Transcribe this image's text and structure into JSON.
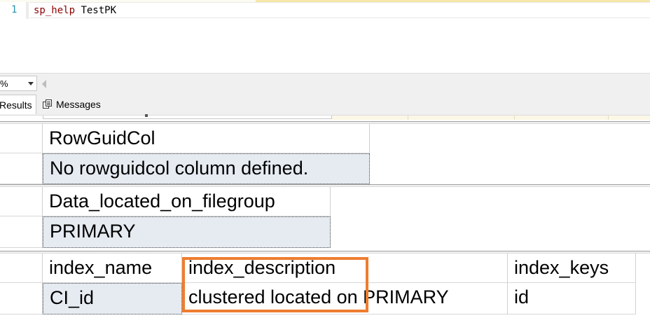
{
  "editor": {
    "line_number": "1",
    "code": {
      "keyword": "sp_help",
      "identifier": " TestPK"
    }
  },
  "zoom": {
    "value": "%"
  },
  "tabs": [
    {
      "label": "Results",
      "icon": "grid-icon"
    },
    {
      "label": "Messages",
      "icon": "messages-icon"
    }
  ],
  "result_sets": [
    {
      "columns": [
        "RowGuidCol"
      ],
      "rows": [
        [
          "No rowguidcol column defined."
        ]
      ]
    },
    {
      "columns": [
        "Data_located_on_filegroup"
      ],
      "rows": [
        [
          "PRIMARY"
        ]
      ]
    },
    {
      "columns": [
        "index_name",
        "index_description",
        "index_keys"
      ],
      "rows": [
        [
          "CI_id",
          "clustered located on PRIMARY",
          "id"
        ]
      ]
    }
  ],
  "colors": {
    "keyword": "#8b0000",
    "line_number": "#2b91af",
    "selected_cell": "#e6ebf2",
    "annotation_highlight": "#ee7d30"
  }
}
